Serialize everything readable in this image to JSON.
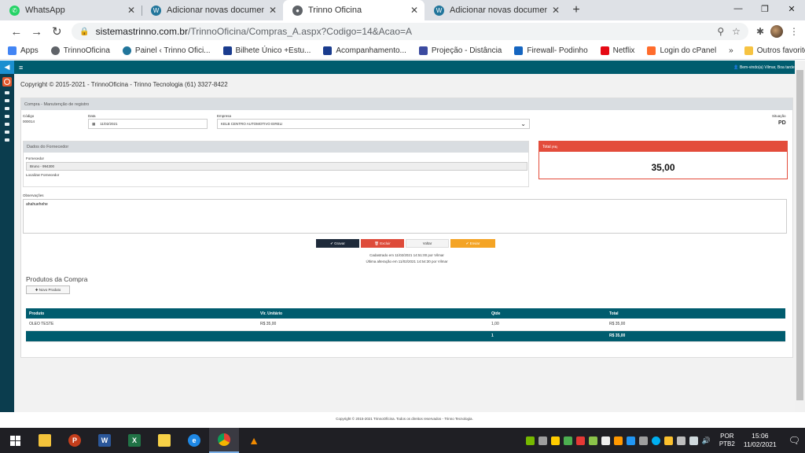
{
  "browser": {
    "tabs": [
      {
        "title": "WhatsApp",
        "fav_color": "#25d366",
        "fav_glyph": "✆",
        "active": false
      },
      {
        "title": "Adicionar novas documentações",
        "fav_color": "#21759b",
        "fav_glyph": "W",
        "active": false
      },
      {
        "title": "Trinno Oficina",
        "fav_color": "#5f6368",
        "fav_glyph": "●",
        "active": true
      },
      {
        "title": "Adicionar novas documentações",
        "fav_color": "#21759b",
        "fav_glyph": "W",
        "active": false
      }
    ],
    "url_host": "sistemastrinno.com.br",
    "url_path": "/TrinnoOficina/Compras_A.aspx?Codigo=14&Acao=A",
    "bookmarks": [
      {
        "label": "Apps",
        "color": "#4285f4"
      },
      {
        "label": "TrinnoOficina",
        "color": "#5f6368"
      },
      {
        "label": "Painel ‹ Trinno Ofici...",
        "color": "#21759b"
      },
      {
        "label": "Bilhete Único +Estu...",
        "color": "#1a3c8e"
      },
      {
        "label": "Acompanhamento...",
        "color": "#1a3c8e"
      },
      {
        "label": "Projeção - Distância",
        "color": "#3b4aa0"
      },
      {
        "label": "Firewall- Podinho",
        "color": "#1565c0"
      },
      {
        "label": "Netflix",
        "color": "#e50914"
      },
      {
        "label": "Login do cPanel",
        "color": "#ff6c2c"
      }
    ],
    "bookmarks_more": "»",
    "other_bookmarks": "Outros favoritos"
  },
  "app": {
    "menu_glyph": "≡",
    "welcome": "Bem-vindo(a) Vilmar, Boa tarde!",
    "copyright_top": "Copyright © 2015-2021 - TrinnoOficina - Trinno Tecnologia (61) 3327-8422",
    "card_title": "Compra - Manutenção de registro",
    "form": {
      "codigo_label": "Código",
      "codigo_value": "000014",
      "data_label": "Data",
      "data_value": "11/02/2021",
      "empresa_label": "Empresa",
      "empresa_value": "KELB CENTRO AUTOMOTIVO EIRELI",
      "situacao_label": "Situação",
      "situacao_value": "PD"
    },
    "fornecedor": {
      "panel_title": "Dados do Fornecedor",
      "label": "Fornecedor",
      "value": "Bruno - 994300",
      "localizar": "Localizar Fornecedor"
    },
    "total": {
      "title": "Total",
      "unit": "(R$)",
      "value": "35,00"
    },
    "observacoes": {
      "label": "Observações",
      "value": "ahahuehehe"
    },
    "buttons": {
      "gravar": "✔ Gravar",
      "excluir": "🗑 Excluir",
      "voltar": "Voltar",
      "enviar": "✔ Enviar"
    },
    "meta": {
      "created": "Cadastrado em 11/02/2021 14:51:00 por Vilmar",
      "updated": "Última alteração em 11/02/2021 14:54:30 por Vilmar"
    },
    "produtos": {
      "title": "Produtos da Compra",
      "new_button": "✚ Novo Produto",
      "columns": [
        "Produto",
        "Vlr. Unitário",
        "Qtde",
        "Total"
      ],
      "rows": [
        [
          "OLEO TESTE",
          "R$ 35,00",
          "1,00",
          "R$ 35,00"
        ]
      ],
      "footer": [
        "",
        "",
        "1",
        "R$ 35,00"
      ]
    },
    "footer_copy": "Copyright © 2015-2021 TrinnoOficina. Todos os direitos reservados - Trinno Tecnologia."
  },
  "taskbar": {
    "apps": [
      {
        "name": "windows-start",
        "color": "#ffffff",
        "glyph": ""
      },
      {
        "name": "file-explorer",
        "color": "#f3c33b",
        "glyph": ""
      },
      {
        "name": "powerpoint",
        "color": "#c43e1c",
        "glyph": "P"
      },
      {
        "name": "word",
        "color": "#2b579a",
        "glyph": "W"
      },
      {
        "name": "excel",
        "color": "#217346",
        "glyph": "X"
      },
      {
        "name": "sticky-notes",
        "color": "#f7d147",
        "glyph": ""
      },
      {
        "name": "edge",
        "color": "#1e88e5",
        "glyph": "e"
      },
      {
        "name": "chrome",
        "color": "#e34133",
        "glyph": "●"
      },
      {
        "name": "vlc",
        "color": "#f08a00",
        "glyph": "▲"
      }
    ],
    "lang_top": "POR",
    "lang_bottom": "PTB2",
    "time": "15:06",
    "date": "11/02/2021"
  }
}
